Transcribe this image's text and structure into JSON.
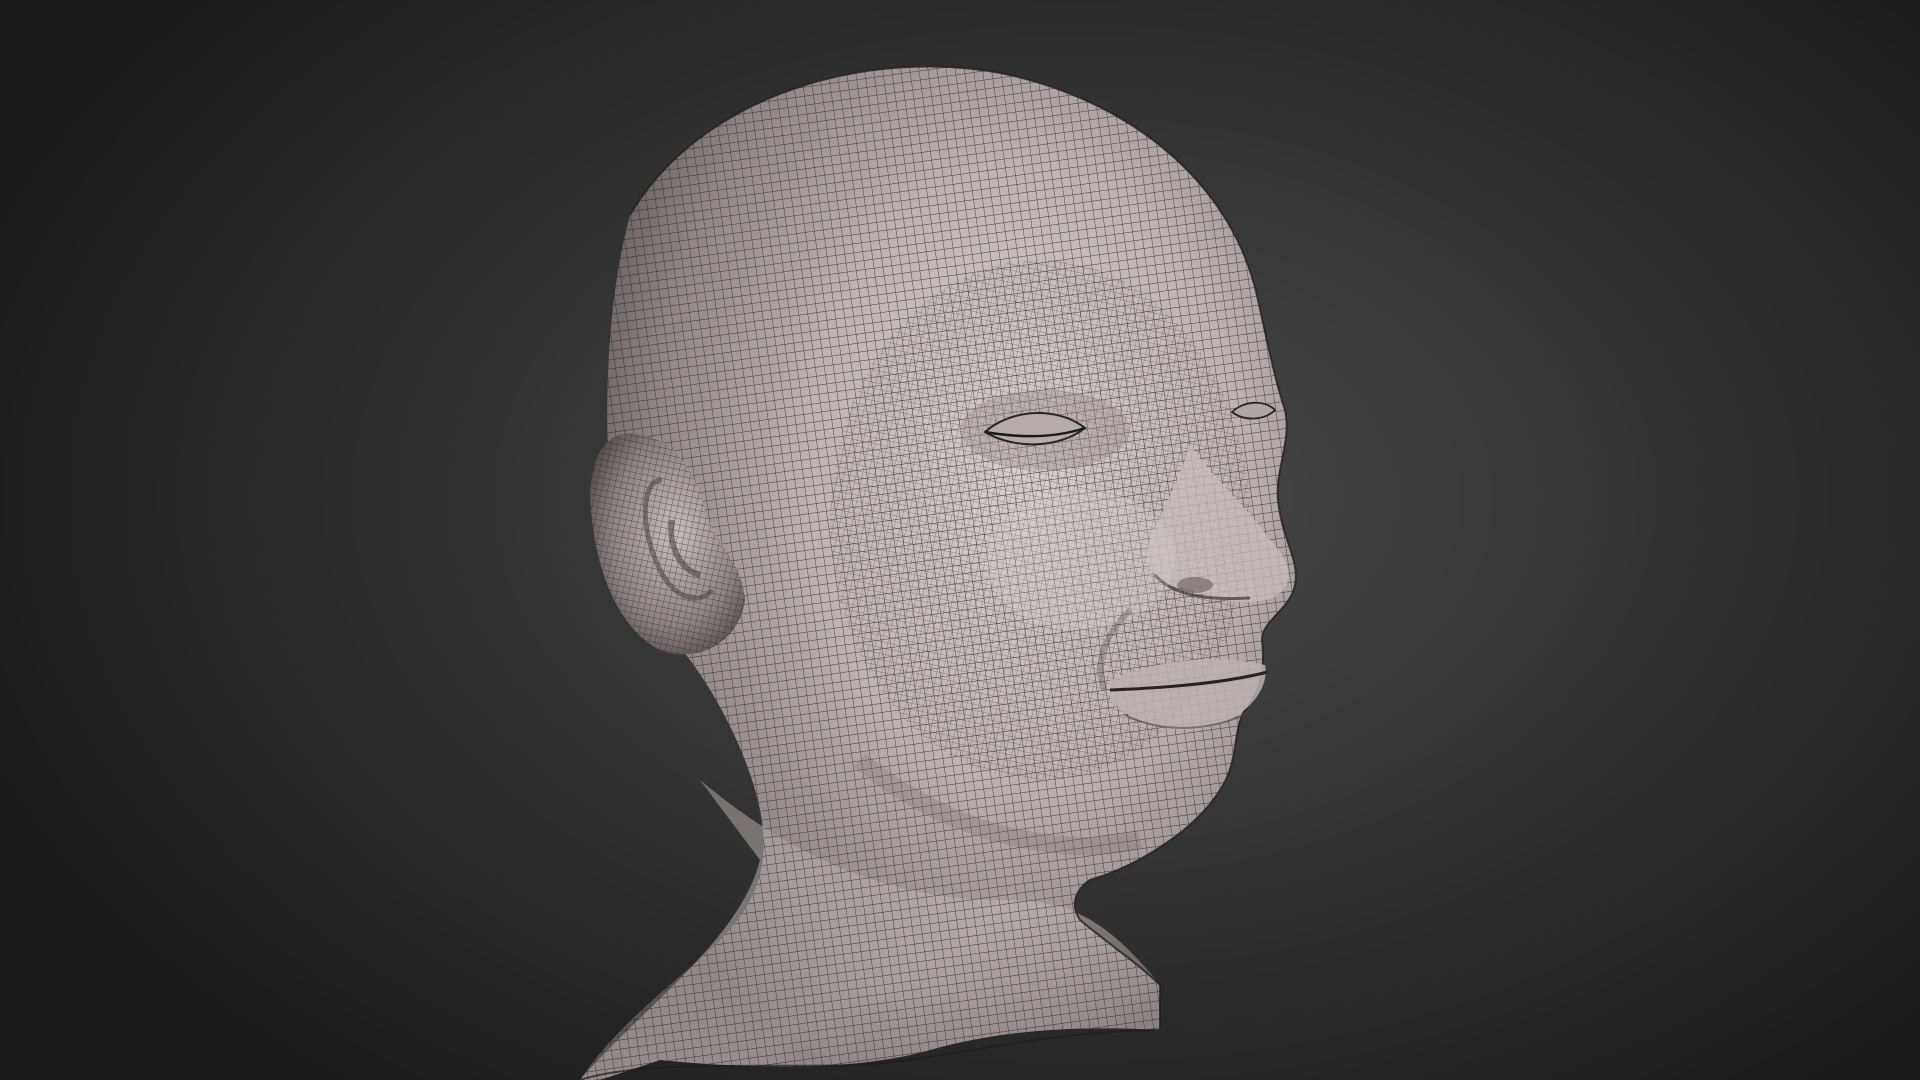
{
  "viewport": {
    "background_color": "#2f2f2f",
    "mesh_base_color": "#bdb3b3",
    "wire_color": "#2a2525"
  },
  "model": {
    "kind": "head-bust-wireframe-mesh"
  }
}
